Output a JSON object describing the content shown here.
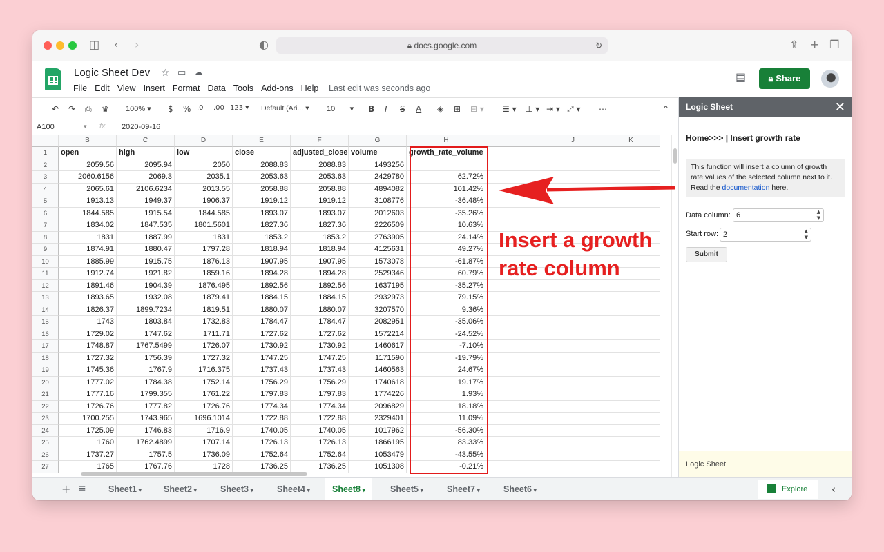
{
  "browser": {
    "url": "docs.google.com"
  },
  "app": {
    "title": "Logic Sheet Dev",
    "menu": [
      "File",
      "Edit",
      "View",
      "Insert",
      "Format",
      "Data",
      "Tools",
      "Add-ons",
      "Help"
    ],
    "last_edit": "Last edit was seconds ago",
    "share_label": "Share"
  },
  "toolbar": {
    "zoom": "100%",
    "currency": "$",
    "percent": "%",
    "dec_less": ".0",
    "dec_more": ".00",
    "format": "123",
    "font": "Default (Ari...",
    "font_size": "10",
    "bold": "B",
    "italic": "I",
    "strike": "S",
    "text_color": "A"
  },
  "formula_bar": {
    "cell_ref": "A100",
    "fx": "fx",
    "value": "2020-09-16"
  },
  "columns": [
    "B",
    "C",
    "D",
    "E",
    "F",
    "G",
    "H",
    "I",
    "J",
    "K"
  ],
  "rows": [
    [
      "1",
      "open",
      "high",
      "low",
      "close",
      "adjusted_close",
      "volume",
      "growth_rate_volume"
    ],
    [
      "2",
      "2059.56",
      "2095.94",
      "2050",
      "2088.83",
      "2088.83",
      "1493256",
      ""
    ],
    [
      "3",
      "2060.6156",
      "2069.3",
      "2035.1",
      "2053.63",
      "2053.63",
      "2429780",
      "62.72%"
    ],
    [
      "4",
      "2065.61",
      "2106.6234",
      "2013.55",
      "2058.88",
      "2058.88",
      "4894082",
      "101.42%"
    ],
    [
      "5",
      "1913.13",
      "1949.37",
      "1906.37",
      "1919.12",
      "1919.12",
      "3108776",
      "-36.48%"
    ],
    [
      "6",
      "1844.585",
      "1915.54",
      "1844.585",
      "1893.07",
      "1893.07",
      "2012603",
      "-35.26%"
    ],
    [
      "7",
      "1834.02",
      "1847.535",
      "1801.5601",
      "1827.36",
      "1827.36",
      "2226509",
      "10.63%"
    ],
    [
      "8",
      "1831",
      "1887.99",
      "1831",
      "1853.2",
      "1853.2",
      "2763905",
      "24.14%"
    ],
    [
      "9",
      "1874.91",
      "1880.47",
      "1797.28",
      "1818.94",
      "1818.94",
      "4125631",
      "49.27%"
    ],
    [
      "10",
      "1885.99",
      "1915.75",
      "1876.13",
      "1907.95",
      "1907.95",
      "1573078",
      "-61.87%"
    ],
    [
      "11",
      "1912.74",
      "1921.82",
      "1859.16",
      "1894.28",
      "1894.28",
      "2529346",
      "60.79%"
    ],
    [
      "12",
      "1891.46",
      "1904.39",
      "1876.495",
      "1892.56",
      "1892.56",
      "1637195",
      "-35.27%"
    ],
    [
      "13",
      "1893.65",
      "1932.08",
      "1879.41",
      "1884.15",
      "1884.15",
      "2932973",
      "79.15%"
    ],
    [
      "14",
      "1826.37",
      "1899.7234",
      "1819.51",
      "1880.07",
      "1880.07",
      "3207570",
      "9.36%"
    ],
    [
      "15",
      "1743",
      "1803.84",
      "1732.83",
      "1784.47",
      "1784.47",
      "2082951",
      "-35.06%"
    ],
    [
      "16",
      "1729.02",
      "1747.62",
      "1711.71",
      "1727.62",
      "1727.62",
      "1572214",
      "-24.52%"
    ],
    [
      "17",
      "1748.87",
      "1767.5499",
      "1726.07",
      "1730.92",
      "1730.92",
      "1460617",
      "-7.10%"
    ],
    [
      "18",
      "1727.32",
      "1756.39",
      "1727.32",
      "1747.25",
      "1747.25",
      "1171590",
      "-19.79%"
    ],
    [
      "19",
      "1745.36",
      "1767.9",
      "1716.375",
      "1737.43",
      "1737.43",
      "1460563",
      "24.67%"
    ],
    [
      "20",
      "1777.02",
      "1784.38",
      "1752.14",
      "1756.29",
      "1756.29",
      "1740618",
      "19.17%"
    ],
    [
      "21",
      "1777.16",
      "1799.355",
      "1761.22",
      "1797.83",
      "1797.83",
      "1774226",
      "1.93%"
    ],
    [
      "22",
      "1726.76",
      "1777.82",
      "1726.76",
      "1774.34",
      "1774.34",
      "2096829",
      "18.18%"
    ],
    [
      "23",
      "1700.255",
      "1743.965",
      "1696.1014",
      "1722.88",
      "1722.88",
      "2329401",
      "11.09%"
    ],
    [
      "24",
      "1725.09",
      "1746.83",
      "1716.9",
      "1740.05",
      "1740.05",
      "1017962",
      "-56.30%"
    ],
    [
      "25",
      "1760",
      "1762.4899",
      "1707.14",
      "1726.13",
      "1726.13",
      "1866195",
      "83.33%"
    ],
    [
      "26",
      "1737.27",
      "1757.5",
      "1736.09",
      "1752.64",
      "1752.64",
      "1053479",
      "-43.55%"
    ],
    [
      "27",
      "1765",
      "1767.76",
      "1728",
      "1736.25",
      "1736.25",
      "1051308",
      "-0.21%"
    ]
  ],
  "sheet_tabs": [
    "Sheet1",
    "Sheet2",
    "Sheet3",
    "Sheet4",
    "Sheet8",
    "Sheet5",
    "Sheet7",
    "Sheet6"
  ],
  "active_tab": "Sheet8",
  "explore_label": "Explore",
  "sidebar": {
    "title": "Logic Sheet",
    "breadcrumb": "Home>>> | Insert growth rate",
    "info_before": "This function will insert a column of growth rate values of the selected column next to it. Read the ",
    "info_link": "documentation",
    "info_after": " here.",
    "data_column_label": "Data column:",
    "data_column_value": "6",
    "start_row_label": "Start row:",
    "start_row_value": "2",
    "submit_label": "Submit",
    "footer": "Logic Sheet"
  },
  "annotation": {
    "line1": "Insert a growth",
    "line2": "rate column",
    "color": "#e62020"
  },
  "colors": {
    "brand_green": "#188038",
    "sidebar_header": "#5f6368"
  }
}
